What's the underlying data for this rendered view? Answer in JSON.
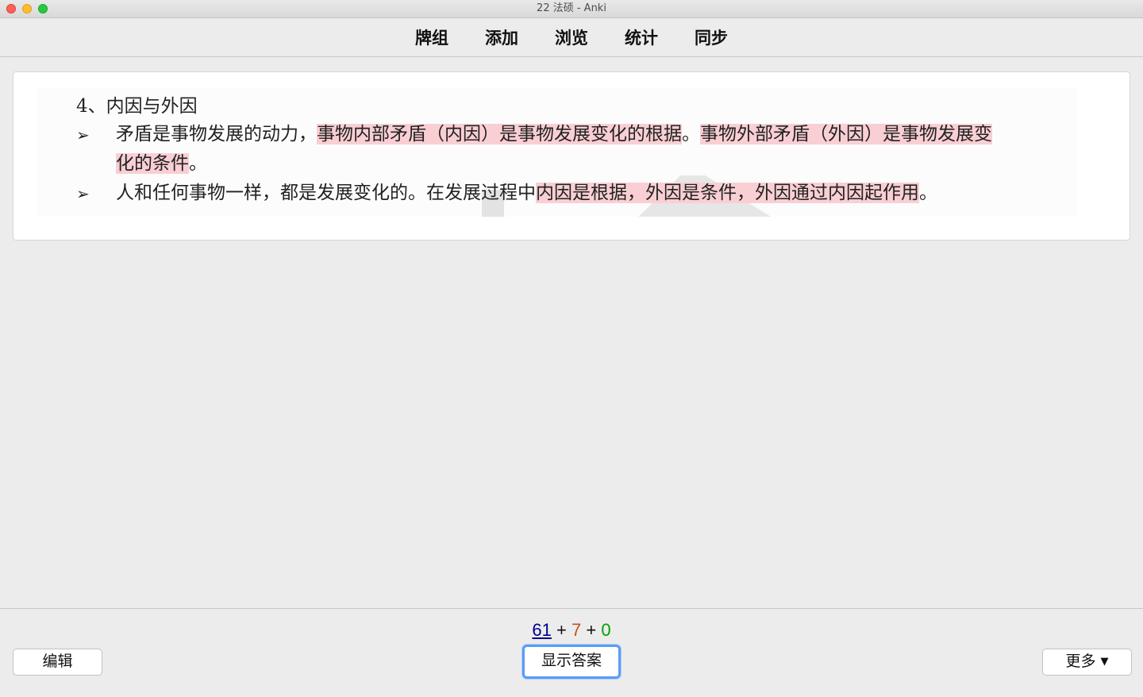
{
  "window": {
    "title": "22 法硕 - Anki"
  },
  "menu": {
    "decks": "牌组",
    "add": "添加",
    "browse": "浏览",
    "stats": "统计",
    "sync": "同步"
  },
  "card": {
    "heading": "4、内因与外因",
    "bullet_glyph": "➢",
    "item1": {
      "t1": "矛盾是事物发展的动力，",
      "h1": "事物内部矛盾（内因）是事物发展变化的根据",
      "t2": "。",
      "h2": "事物外部矛盾（外因）是事物发展变",
      "h3": "化的条件",
      "t3": "。"
    },
    "item2": {
      "t1": "人和任何事物一样，都是发展变化的。在发展过程中",
      "h1": "内因是根据，外因是条件，外因通过内因起作用",
      "t2": "。"
    }
  },
  "bottom": {
    "count_new": "61",
    "plus1": " + ",
    "count_learn": "7",
    "plus2": " + ",
    "count_review": "0",
    "edit_label": "编辑",
    "show_answer_label": "显示答案",
    "more_label": "更多",
    "more_caret": "▼"
  },
  "colors": {
    "highlight": "#f9cfd4",
    "new_count": "#00008b",
    "learn_count": "#c35617",
    "review_count": "#00a000",
    "focus_ring": "#5b9cf5"
  }
}
